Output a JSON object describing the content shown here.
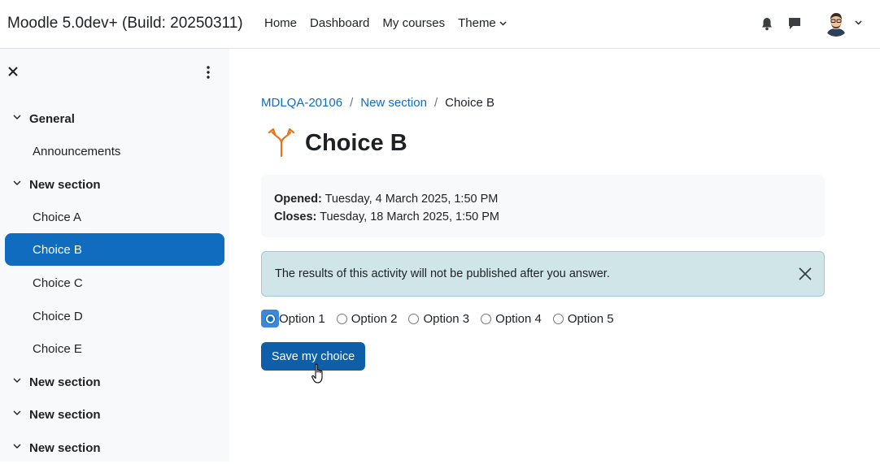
{
  "navbar": {
    "site_name": "Moodle 5.0dev+ (Build: 20250311)",
    "links": [
      "Home",
      "Dashboard",
      "My courses"
    ],
    "theme_label": "Theme"
  },
  "drawer": {
    "items": [
      {
        "type": "section",
        "label": "General"
      },
      {
        "type": "activity",
        "label": "Announcements"
      },
      {
        "type": "section",
        "label": "New section"
      },
      {
        "type": "activity",
        "label": "Choice A"
      },
      {
        "type": "activity",
        "label": "Choice B",
        "active": true
      },
      {
        "type": "activity",
        "label": "Choice C"
      },
      {
        "type": "activity",
        "label": "Choice D"
      },
      {
        "type": "activity",
        "label": "Choice E"
      },
      {
        "type": "section",
        "label": "New section"
      },
      {
        "type": "section",
        "label": "New section"
      },
      {
        "type": "section",
        "label": "New section"
      }
    ]
  },
  "breadcrumb": {
    "items": [
      "MDLQA-20106",
      "New section",
      "Choice B"
    ],
    "separator": "/"
  },
  "page": {
    "title": "Choice B",
    "opened_label": "Opened:",
    "opened_value": "Tuesday, 4 March 2025, 1:50 PM",
    "closes_label": "Closes:",
    "closes_value": "Tuesday, 18 March 2025, 1:50 PM",
    "alert_text": "The results of this activity will not be published after you answer.",
    "options": [
      "Option 1",
      "Option 2",
      "Option 3",
      "Option 4",
      "Option 5"
    ],
    "selected_option": "Option 1",
    "save_label": "Save my choice"
  },
  "colors": {
    "accent": "#0f6cbf",
    "alert_bg": "#cfe5e8",
    "choice_icon": "#e8731d"
  }
}
